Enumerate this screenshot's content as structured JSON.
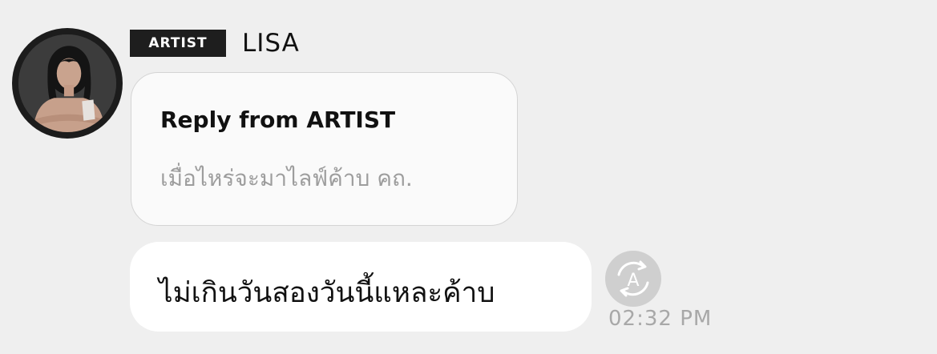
{
  "sender": {
    "badge": "ARTIST",
    "name": "LISA",
    "avatar_icon": "user-avatar"
  },
  "reply_card": {
    "title": "Reply from ARTIST",
    "quoted_message": "เมื่อไหร่จะมาไลฟ์ค้าบ คถ."
  },
  "message": {
    "text": "ไม่เกินวันสองวันนี้แหละค้าบ",
    "timestamp": "02:32 PM",
    "translate_icon": "translate-icon",
    "translate_glyph": "A"
  },
  "colors": {
    "background": "#efefef",
    "badge_bg": "#1e1e1e",
    "bubble_bg": "#ffffff",
    "muted_text": "#9d9d9d"
  }
}
